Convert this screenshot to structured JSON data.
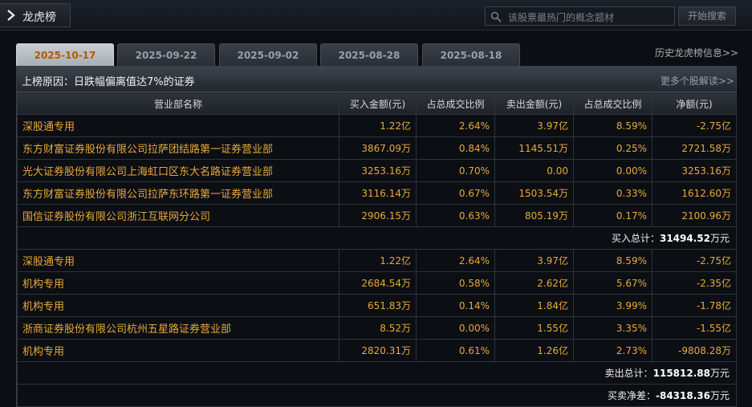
{
  "header": {
    "title": "龙虎榜",
    "search_placeholder": "该股票最热门的概念题材",
    "search_button": "开始搜索"
  },
  "tabs": [
    {
      "label": "2025-10-17",
      "active": true
    },
    {
      "label": "2025-09-22",
      "active": false
    },
    {
      "label": "2025-09-02",
      "active": false
    },
    {
      "label": "2025-08-28",
      "active": false
    },
    {
      "label": "2025-08-18",
      "active": false
    }
  ],
  "history_link": "历史龙虎榜信息>>",
  "reason": {
    "text": "上榜原因：日跌幅偏离值达7%的证券",
    "more_link": "更多个股解读>>"
  },
  "columns": [
    "营业部名称",
    "买入金额(元)",
    "占总成交比例",
    "卖出金额(元)",
    "占总成交比例",
    "净额(元)"
  ],
  "buy_rows": [
    [
      "深股通专用",
      "1.22亿",
      "2.64%",
      "3.97亿",
      "8.59%",
      "-2.75亿"
    ],
    [
      "东方财富证券股份有限公司拉萨团结路第一证券营业部",
      "3867.09万",
      "0.84%",
      "1145.51万",
      "0.25%",
      "2721.58万"
    ],
    [
      "光大证券股份有限公司上海虹口区东大名路证券营业部",
      "3253.16万",
      "0.70%",
      "0.00",
      "0.00%",
      "3253.16万"
    ],
    [
      "东方财富证券股份有限公司拉萨东环路第一证券营业部",
      "3116.14万",
      "0.67%",
      "1503.54万",
      "0.33%",
      "1612.60万"
    ],
    [
      "国信证券股份有限公司浙江互联网分公司",
      "2906.15万",
      "0.63%",
      "805.19万",
      "0.17%",
      "2100.96万"
    ]
  ],
  "buy_total": {
    "label": "买入总计：",
    "value": "31494.52",
    "unit": "万元"
  },
  "sell_rows": [
    [
      "深股通专用",
      "1.22亿",
      "2.64%",
      "3.97亿",
      "8.59%",
      "-2.75亿"
    ],
    [
      "机构专用",
      "2684.54万",
      "0.58%",
      "2.62亿",
      "5.67%",
      "-2.35亿"
    ],
    [
      "机构专用",
      "651.83万",
      "0.14%",
      "1.84亿",
      "3.99%",
      "-1.78亿"
    ],
    [
      "浙商证券股份有限公司杭州五星路证券营业部",
      "8.52万",
      "0.00%",
      "1.55亿",
      "3.35%",
      "-1.55亿"
    ],
    [
      "机构专用",
      "2820.31万",
      "0.61%",
      "1.26亿",
      "2.73%",
      "-9808.28万"
    ]
  ],
  "sell_total": {
    "label": "卖出总计：",
    "value": "115812.88",
    "unit": "万元"
  },
  "net_total": {
    "label": "买卖净差：",
    "value": "-84318.36",
    "unit": "万元"
  }
}
